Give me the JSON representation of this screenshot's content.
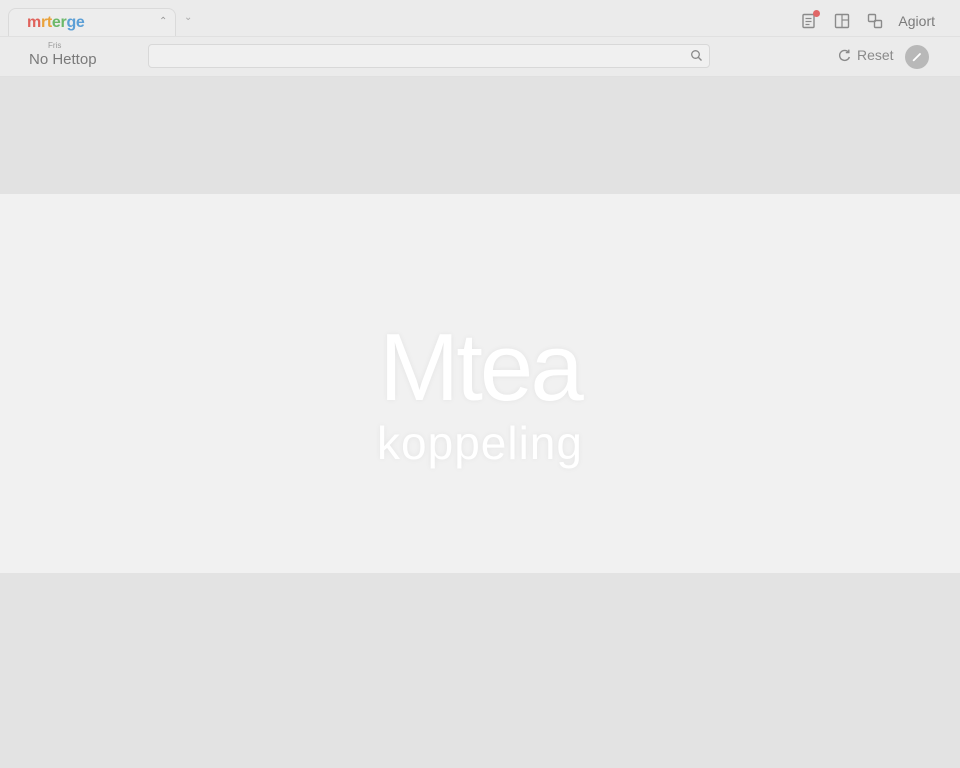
{
  "app": {
    "logo_parts": [
      "m",
      "rt",
      "er",
      "ge"
    ],
    "tab_close": "⌃",
    "tab_menu": "⌄"
  },
  "toolbar": {
    "icons": [
      "notes-icon",
      "layout-icon",
      "arrange-icon"
    ],
    "export_label": "Agiort",
    "notification_color": "#e06666"
  },
  "file": {
    "label": "Fris",
    "name": "No Hettop"
  },
  "search": {
    "value": "",
    "placeholder": ""
  },
  "actions": {
    "reset_label": "Reset",
    "edit_icon": "pencil-icon"
  },
  "hero": {
    "title": "Mtea",
    "subtitle": "koppeling"
  }
}
